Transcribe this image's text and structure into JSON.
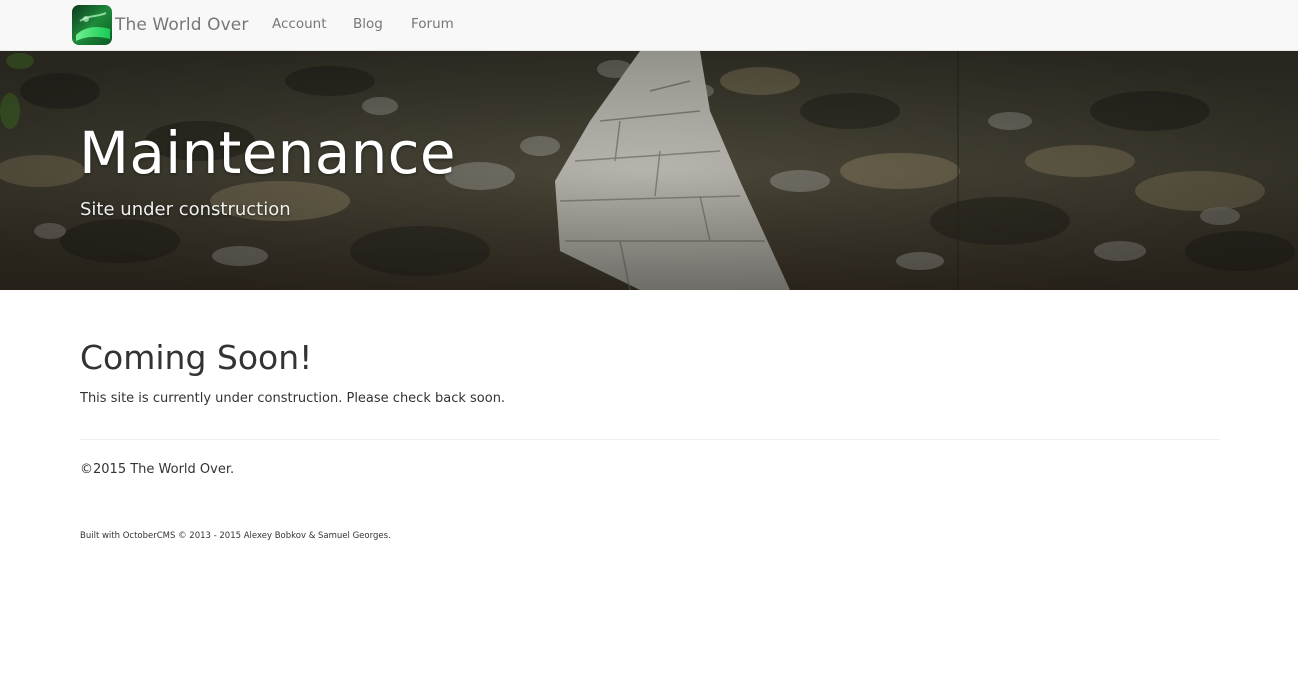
{
  "navbar": {
    "brand_name": "The World Over",
    "brand_logo_icon": "leaf-logo-icon",
    "links": [
      {
        "label": "Account"
      },
      {
        "label": "Blog"
      },
      {
        "label": "Forum"
      }
    ]
  },
  "hero": {
    "title": "Maintenance",
    "subtitle": "Site under construction",
    "background_image": "stone-path-forest-photo"
  },
  "main": {
    "heading": "Coming Soon!",
    "message": "This site is currently under construction. Please check back soon."
  },
  "footer": {
    "copyright": "©2015 The World Over.",
    "built_with": "Built with OctoberCMS © 2013 - 2015 Alexey Bobkov & Samuel Georges."
  },
  "colors": {
    "navbar_bg": "#f8f8f8",
    "nav_text": "#777777",
    "body_text": "#333333",
    "divider": "#eeeeee"
  }
}
